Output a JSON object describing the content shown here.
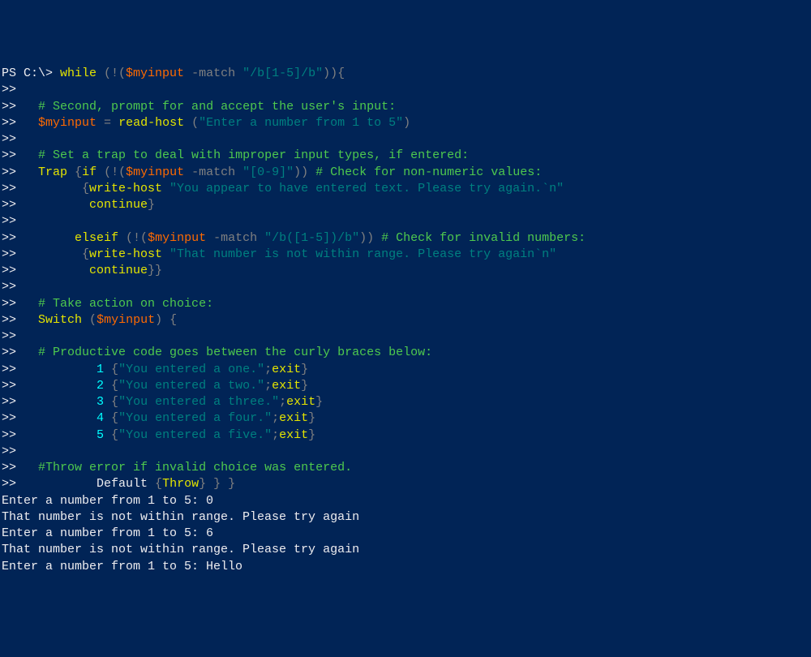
{
  "lines": [
    {
      "cont": false,
      "prompt": "PS C:\\> ",
      "tokens": [
        {
          "c": "y",
          "t": "while"
        },
        {
          "c": "gr",
          "t": " (!("
        },
        {
          "c": "o",
          "t": "$myinput"
        },
        {
          "c": "gr",
          "t": " -match "
        },
        {
          "c": "t",
          "t": "\"/b[1-5]/b\""
        },
        {
          "c": "gr",
          "t": ")){"
        }
      ]
    },
    {
      "cont": true,
      "tokens": []
    },
    {
      "cont": true,
      "tokens": [
        {
          "c": "w",
          "t": "  "
        },
        {
          "c": "g",
          "t": "# Second, prompt for and accept the user's input:"
        }
      ]
    },
    {
      "cont": true,
      "tokens": [
        {
          "c": "w",
          "t": "  "
        },
        {
          "c": "o",
          "t": "$myinput"
        },
        {
          "c": "gr",
          "t": " = "
        },
        {
          "c": "y",
          "t": "read-host"
        },
        {
          "c": "gr",
          "t": " ("
        },
        {
          "c": "t",
          "t": "\"Enter a number from 1 to 5\""
        },
        {
          "c": "gr",
          "t": ")"
        }
      ]
    },
    {
      "cont": true,
      "tokens": []
    },
    {
      "cont": true,
      "tokens": [
        {
          "c": "w",
          "t": "  "
        },
        {
          "c": "g",
          "t": "# Set a trap to deal with improper input types, if entered:"
        }
      ]
    },
    {
      "cont": true,
      "tokens": [
        {
          "c": "w",
          "t": "  "
        },
        {
          "c": "y",
          "t": "Trap"
        },
        {
          "c": "gr",
          "t": " {"
        },
        {
          "c": "y",
          "t": "if"
        },
        {
          "c": "gr",
          "t": " (!("
        },
        {
          "c": "o",
          "t": "$myinput"
        },
        {
          "c": "gr",
          "t": " -match "
        },
        {
          "c": "t",
          "t": "\"[0-9]\""
        },
        {
          "c": "gr",
          "t": ")) "
        },
        {
          "c": "g",
          "t": "# Check for non-numeric values:"
        }
      ]
    },
    {
      "cont": true,
      "tokens": [
        {
          "c": "gr",
          "t": "        {"
        },
        {
          "c": "y",
          "t": "write-host"
        },
        {
          "c": "t",
          "t": " \"You appear to have entered text. Please try again.`n\""
        }
      ]
    },
    {
      "cont": true,
      "tokens": [
        {
          "c": "y",
          "t": "         continue"
        },
        {
          "c": "gr",
          "t": "}"
        }
      ]
    },
    {
      "cont": true,
      "tokens": []
    },
    {
      "cont": true,
      "tokens": [
        {
          "c": "y",
          "t": "       elseif"
        },
        {
          "c": "gr",
          "t": " (!("
        },
        {
          "c": "o",
          "t": "$myinput"
        },
        {
          "c": "gr",
          "t": " -match "
        },
        {
          "c": "t",
          "t": "\"/b([1-5])/b\""
        },
        {
          "c": "gr",
          "t": ")) "
        },
        {
          "c": "g",
          "t": "# Check for invalid numbers:"
        }
      ]
    },
    {
      "cont": true,
      "tokens": [
        {
          "c": "gr",
          "t": "        {"
        },
        {
          "c": "y",
          "t": "write-host"
        },
        {
          "c": "t",
          "t": " \"That number is not within range. Please try again`n\""
        }
      ]
    },
    {
      "cont": true,
      "tokens": [
        {
          "c": "y",
          "t": "         continue"
        },
        {
          "c": "gr",
          "t": "}}"
        }
      ]
    },
    {
      "cont": true,
      "tokens": []
    },
    {
      "cont": true,
      "tokens": [
        {
          "c": "w",
          "t": "  "
        },
        {
          "c": "g",
          "t": "# Take action on choice:"
        }
      ]
    },
    {
      "cont": true,
      "tokens": [
        {
          "c": "w",
          "t": "  "
        },
        {
          "c": "y",
          "t": "Switch"
        },
        {
          "c": "gr",
          "t": " ("
        },
        {
          "c": "o",
          "t": "$myinput"
        },
        {
          "c": "gr",
          "t": ") {"
        }
      ]
    },
    {
      "cont": true,
      "tokens": []
    },
    {
      "cont": true,
      "tokens": [
        {
          "c": "w",
          "t": "  "
        },
        {
          "c": "g",
          "t": "# Productive code goes between the curly braces below:"
        }
      ]
    },
    {
      "cont": true,
      "tokens": [
        {
          "c": "w",
          "t": "          "
        },
        {
          "c": "c",
          "t": "1"
        },
        {
          "c": "gr",
          "t": " {"
        },
        {
          "c": "t",
          "t": "\"You entered a one.\""
        },
        {
          "c": "gr",
          "t": ";"
        },
        {
          "c": "y",
          "t": "exit"
        },
        {
          "c": "gr",
          "t": "}"
        }
      ]
    },
    {
      "cont": true,
      "tokens": [
        {
          "c": "w",
          "t": "          "
        },
        {
          "c": "c",
          "t": "2"
        },
        {
          "c": "gr",
          "t": " {"
        },
        {
          "c": "t",
          "t": "\"You entered a two.\""
        },
        {
          "c": "gr",
          "t": ";"
        },
        {
          "c": "y",
          "t": "exit"
        },
        {
          "c": "gr",
          "t": "}"
        }
      ]
    },
    {
      "cont": true,
      "tokens": [
        {
          "c": "w",
          "t": "          "
        },
        {
          "c": "c",
          "t": "3"
        },
        {
          "c": "gr",
          "t": " {"
        },
        {
          "c": "t",
          "t": "\"You entered a three.\""
        },
        {
          "c": "gr",
          "t": ";"
        },
        {
          "c": "y",
          "t": "exit"
        },
        {
          "c": "gr",
          "t": "}"
        }
      ]
    },
    {
      "cont": true,
      "tokens": [
        {
          "c": "w",
          "t": "          "
        },
        {
          "c": "c",
          "t": "4"
        },
        {
          "c": "gr",
          "t": " {"
        },
        {
          "c": "t",
          "t": "\"You entered a four.\""
        },
        {
          "c": "gr",
          "t": ";"
        },
        {
          "c": "y",
          "t": "exit"
        },
        {
          "c": "gr",
          "t": "}"
        }
      ]
    },
    {
      "cont": true,
      "tokens": [
        {
          "c": "w",
          "t": "          "
        },
        {
          "c": "c",
          "t": "5"
        },
        {
          "c": "gr",
          "t": " {"
        },
        {
          "c": "t",
          "t": "\"You entered a five.\""
        },
        {
          "c": "gr",
          "t": ";"
        },
        {
          "c": "y",
          "t": "exit"
        },
        {
          "c": "gr",
          "t": "}"
        }
      ]
    },
    {
      "cont": true,
      "tokens": []
    },
    {
      "cont": true,
      "tokens": [
        {
          "c": "w",
          "t": "  "
        },
        {
          "c": "g",
          "t": "#Throw error if invalid choice was entered."
        }
      ]
    },
    {
      "cont": true,
      "tokens": [
        {
          "c": "w",
          "t": "          Default "
        },
        {
          "c": "gr",
          "t": "{"
        },
        {
          "c": "y",
          "t": "Throw"
        },
        {
          "c": "gr",
          "t": "} } }"
        }
      ]
    },
    {
      "cont": false,
      "prompt": "",
      "tokens": [
        {
          "c": "w",
          "t": "Enter a number from 1 to 5: 0"
        }
      ]
    },
    {
      "cont": false,
      "prompt": "",
      "tokens": [
        {
          "c": "w",
          "t": "That number is not within range. Please try again"
        }
      ]
    },
    {
      "cont": false,
      "prompt": "",
      "tokens": [
        {
          "c": "w",
          "t": ""
        }
      ]
    },
    {
      "cont": false,
      "prompt": "",
      "tokens": [
        {
          "c": "w",
          "t": "Enter a number from 1 to 5: 6"
        }
      ]
    },
    {
      "cont": false,
      "prompt": "",
      "tokens": [
        {
          "c": "w",
          "t": "That number is not within range. Please try again"
        }
      ]
    },
    {
      "cont": false,
      "prompt": "",
      "tokens": [
        {
          "c": "w",
          "t": ""
        }
      ]
    },
    {
      "cont": false,
      "prompt": "",
      "tokens": [
        {
          "c": "w",
          "t": "Enter a number from 1 to 5: Hello"
        }
      ]
    }
  ],
  "cont_prompt": ">> "
}
